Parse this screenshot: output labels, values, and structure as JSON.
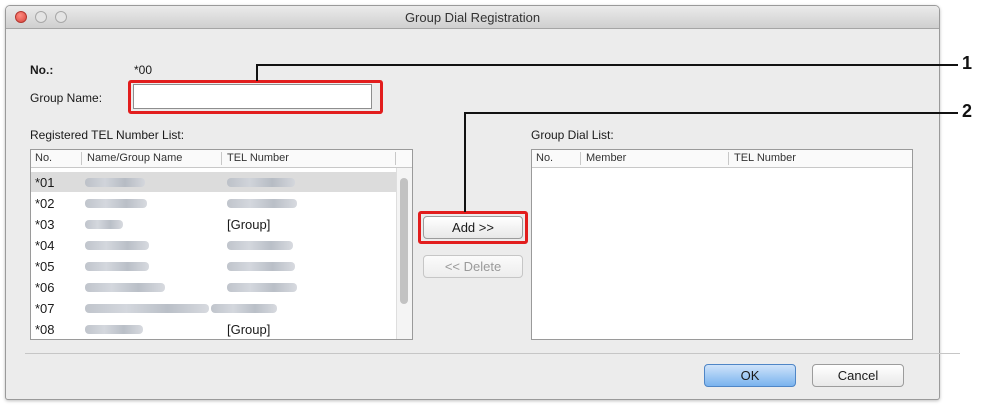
{
  "window": {
    "title": "Group Dial Registration"
  },
  "form": {
    "no_label": "No.:",
    "no_value": "*00",
    "group_name_label": "Group Name:",
    "group_name_value": "",
    "registered_list_label": "Registered TEL Number List:",
    "group_dial_list_label": "Group Dial List:"
  },
  "registered_table": {
    "columns": [
      "No.",
      "Name/Group Name",
      "TEL Number"
    ],
    "rows": [
      {
        "no": "*01",
        "tel": ""
      },
      {
        "no": "*02",
        "tel": ""
      },
      {
        "no": "*03",
        "tel": "[Group]"
      },
      {
        "no": "*04",
        "tel": ""
      },
      {
        "no": "*05",
        "tel": ""
      },
      {
        "no": "*06",
        "tel": ""
      },
      {
        "no": "*07",
        "tel": ""
      },
      {
        "no": "*08",
        "tel": "[Group]"
      }
    ]
  },
  "group_table": {
    "columns": [
      "No.",
      "Member",
      "TEL Number"
    ]
  },
  "buttons": {
    "add": "Add >>",
    "delete": "<< Delete",
    "ok": "OK",
    "cancel": "Cancel"
  },
  "callouts": [
    "1",
    "2"
  ],
  "colors": {
    "highlight": "#e21d1d",
    "default_button": "#7ab3ee",
    "close_button": "#d8453c"
  }
}
